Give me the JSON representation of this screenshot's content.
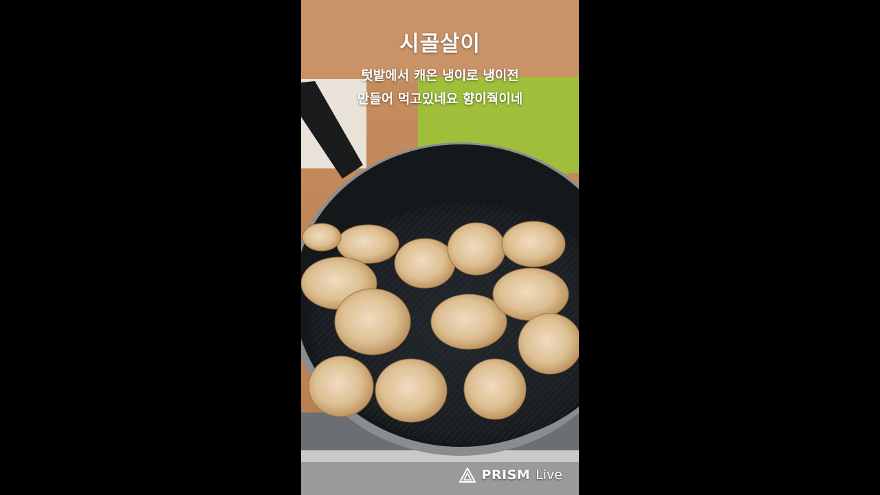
{
  "video": {
    "title": "시골살이",
    "caption_line1": "텃밭에서 캐온 냉이로 냉이전",
    "caption_line2": "만들어 먹고있네요 향이줙이네",
    "pan_icon": "frying-pan-with-fritters"
  },
  "watermark": {
    "brand": "PRISM",
    "suffix": "Live",
    "icon": "prism-triangle-icon"
  },
  "colors": {
    "background": "#000000",
    "caption_text": "#ffffff"
  }
}
